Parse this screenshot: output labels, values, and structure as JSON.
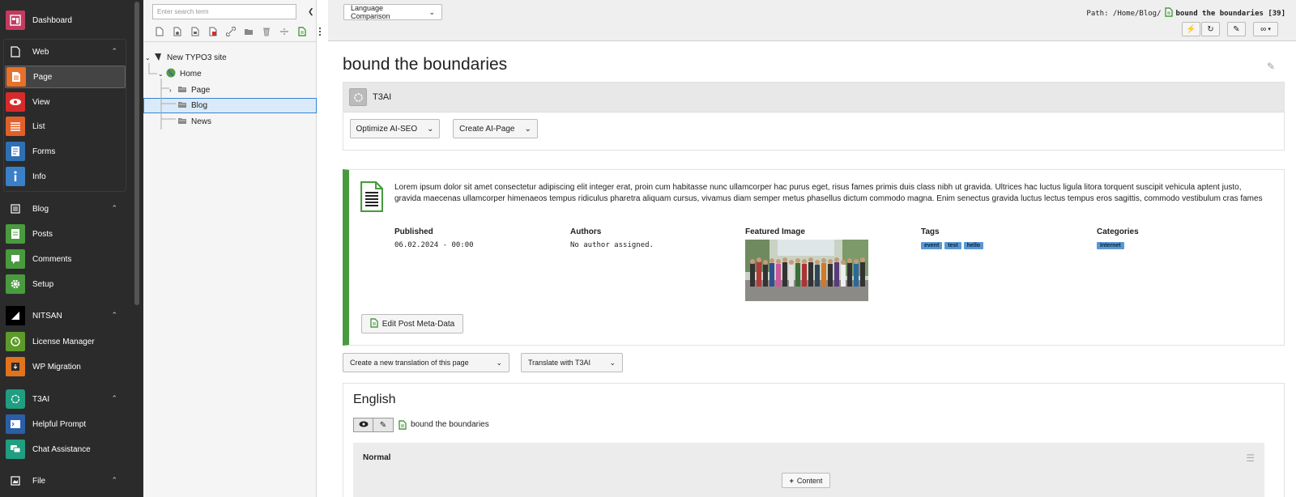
{
  "modules": {
    "dashboard": "Dashboard",
    "web_group": "Web",
    "page": "Page",
    "view": "View",
    "list": "List",
    "forms": "Forms",
    "info": "Info",
    "blog_group": "Blog",
    "posts": "Posts",
    "comments": "Comments",
    "setup": "Setup",
    "nitsan_group": "NITSAN",
    "license_manager": "License Manager",
    "wp_migration": "WP Migration",
    "t3ai_group": "T3AI",
    "helpful_prompt": "Helpful Prompt",
    "chat_assistance": "Chat Assistance",
    "file_group": "File"
  },
  "tree": {
    "search_placeholder": "Enter search term",
    "site": "New TYPO3 site",
    "home": "Home",
    "page": "Page",
    "blog": "Blog",
    "news": "News"
  },
  "header": {
    "view_select": "Language Comparison",
    "path_label": "Path: /Home/Blog/",
    "page_title": "bound the boundaries [39]"
  },
  "content": {
    "title": "bound the boundaries",
    "t3ai_panel_title": "T3AI",
    "optimize_btn": "Optimize AI-SEO",
    "create_page_btn": "Create AI-Page",
    "post_text": "Lorem ipsum dolor sit amet consectetur adipiscing elit integer erat, proin cum habitasse nunc ullamcorper hac purus eget, risus fames primis duis class nibh ut gravida. Ultrices hac luctus ligula litora torquent suscipit vehicula aptent justo, gravida maecenas ullamcorper himenaeos tempus ridiculus pharetra aliquam cursus, vivamus diam semper metus phasellus dictum commodo magna. Enim senectus gravida luctus lectus tempus eros sagittis, commodo vestibulum cras fames",
    "published_label": "Published",
    "published_value": "06.02.2024 - 00:00",
    "authors_label": "Authors",
    "authors_value": "No author assigned.",
    "featured_label": "Featured Image",
    "tags_label": "Tags",
    "tags": [
      "event",
      "test",
      "hello"
    ],
    "categories_label": "Categories",
    "categories": [
      "Internet"
    ],
    "edit_meta_btn": "Edit Post Meta-Data",
    "translation_select": "Create a new translation of this page",
    "translate_t3ai": "Translate with T3AI",
    "language": "English",
    "lang_page_title": "bound the boundaries",
    "column_label": "Normal",
    "add_content": "Content"
  },
  "colors": {
    "accent_green": "#4a9a3f",
    "tag_blue": "#5a98d3",
    "selection": "#dbeaf8"
  }
}
